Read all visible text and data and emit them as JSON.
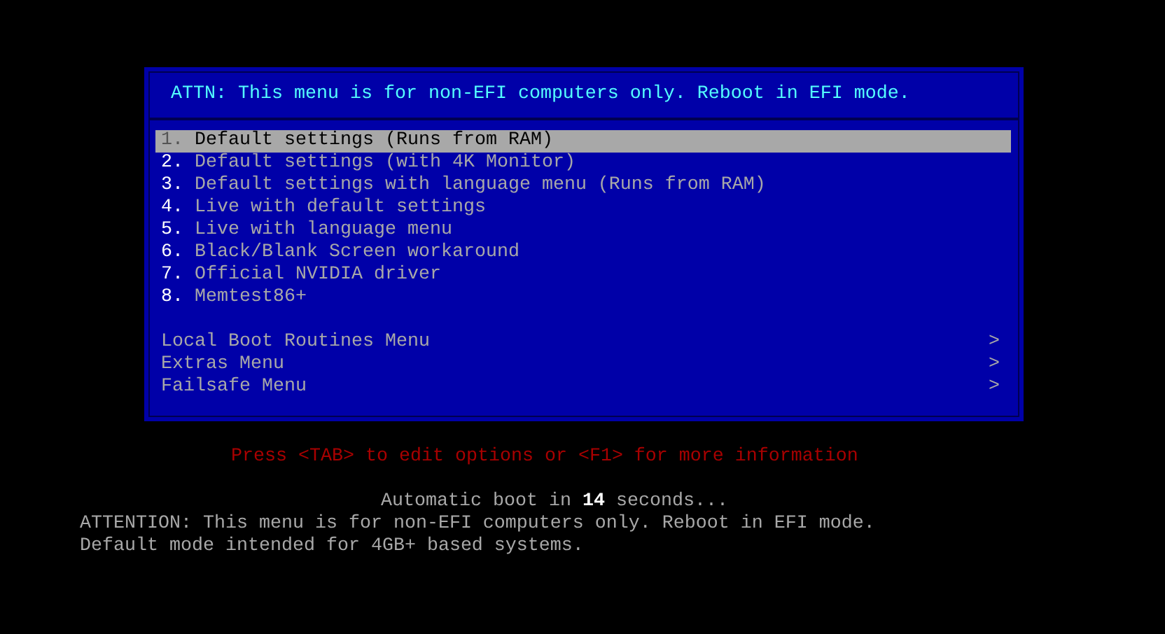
{
  "menu": {
    "title": "ATTN: This menu is for non-EFI computers only. Reboot in EFI mode.",
    "entries": [
      {
        "number": "1.",
        "label": "Default settings (Runs from RAM)",
        "selected": true
      },
      {
        "number": "2.",
        "label": "Default settings (with 4K Monitor)",
        "selected": false
      },
      {
        "number": "3.",
        "label": "Default settings with language menu (Runs from RAM)",
        "selected": false
      },
      {
        "number": "4.",
        "label": "Live with default settings",
        "selected": false
      },
      {
        "number": "5.",
        "label": "Live with language menu",
        "selected": false
      },
      {
        "number": "6.",
        "label": "Black/Blank Screen workaround",
        "selected": false
      },
      {
        "number": "7.",
        "label": "Official NVIDIA driver",
        "selected": false
      },
      {
        "number": "8.",
        "label": "Memtest86+",
        "selected": false
      }
    ],
    "submenus": [
      {
        "label": "Local Boot Routines Menu",
        "arrow": ">",
        "selected": false
      },
      {
        "label": "Extras Menu",
        "arrow": ">",
        "selected": false
      },
      {
        "label": "Failsafe Menu",
        "arrow": ">",
        "selected": false
      }
    ]
  },
  "help_hint": "Press <TAB> to edit options or <F1> for more information",
  "countdown": "Automatic boot in **14** seconds...",
  "notes": [
    "ATTENTION: This menu is for non-EFI computers only. Reboot in EFI mode.",
    "Default mode intended for 4GB+ based systems."
  ]
}
